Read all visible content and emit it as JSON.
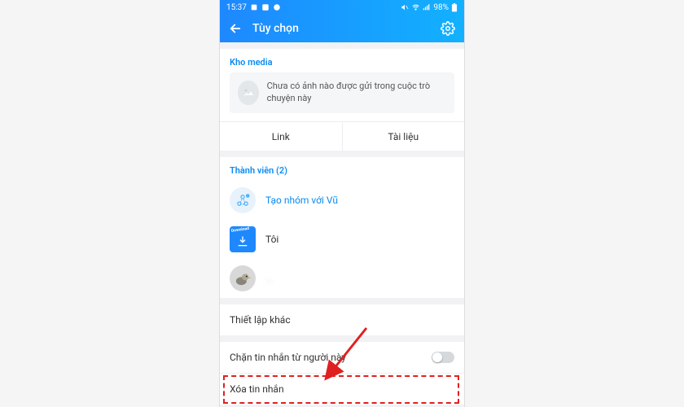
{
  "status": {
    "time": "15:37",
    "battery": "98%"
  },
  "appbar": {
    "title": "Tùy chọn"
  },
  "media": {
    "header": "Kho media",
    "empty_text": "Chưa có ảnh nào được gửi trong cuộc trò chuyện này",
    "tab_link": "Link",
    "tab_docs": "Tài liệu"
  },
  "members": {
    "header": "Thành viên (2)",
    "create_group": "Tạo nhóm với Vũ",
    "me": "Tôi",
    "other": "…"
  },
  "other_settings": {
    "header": "Thiết lập khác",
    "block": "Chặn tin nhắn từ người này",
    "delete": "Xóa tin nhắn"
  }
}
